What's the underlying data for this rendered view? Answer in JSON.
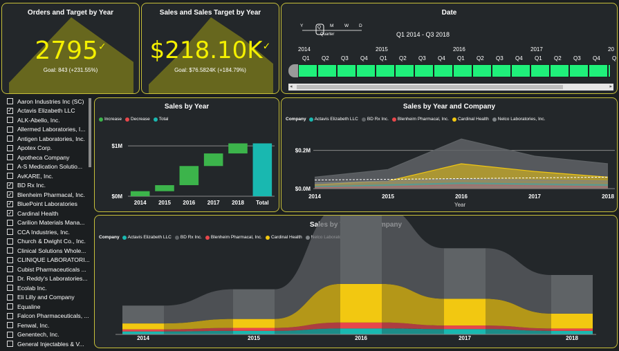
{
  "orders_card": {
    "title": "Orders and Target by Year",
    "value": "2795",
    "goal": "Goal: 843 (+231.55%)"
  },
  "sales_card": {
    "title": "Sales and Sales Target by Year",
    "value": "$218.10K",
    "goal": "Goal: $76.5824K (+184.79%)"
  },
  "date_slicer": {
    "title": "Date",
    "levels": [
      "Y",
      "Q",
      "M",
      "W",
      "D"
    ],
    "selected_level": "Quarter",
    "range": "Q1 2014 - Q3 2018",
    "years": [
      "2014",
      "2015",
      "2016",
      "2017",
      "20"
    ],
    "quarters": [
      "Q1",
      "Q2",
      "Q3",
      "Q4",
      "Q1",
      "Q2",
      "Q3",
      "Q4",
      "Q1",
      "Q2",
      "Q3",
      "Q4",
      "Q1",
      "Q2",
      "Q3",
      "Q4",
      "Q"
    ]
  },
  "company_slicer": {
    "items": [
      {
        "label": "Aaron Industries Inc (SC)",
        "checked": false
      },
      {
        "label": "Actavis Elizabeth LLC",
        "checked": true
      },
      {
        "label": "ALK-Abello, Inc.",
        "checked": false
      },
      {
        "label": "Allermed Laboratories, I...",
        "checked": false
      },
      {
        "label": "Antigen Laboratories, Inc.",
        "checked": false
      },
      {
        "label": "Apotex Corp.",
        "checked": false
      },
      {
        "label": "Apotheca Company",
        "checked": false
      },
      {
        "label": "A-S Medication Solutio...",
        "checked": false
      },
      {
        "label": "AvKARE, Inc.",
        "checked": false
      },
      {
        "label": "BD Rx Inc.",
        "checked": true
      },
      {
        "label": "Blenheim Pharmacal, Inc.",
        "checked": true
      },
      {
        "label": "BluePoint Laboratories",
        "checked": true
      },
      {
        "label": "Cardinal Health",
        "checked": true
      },
      {
        "label": "Carilion Materials Mana...",
        "checked": false
      },
      {
        "label": "CCA Industries, Inc.",
        "checked": false
      },
      {
        "label": "Church & Dwight Co., Inc.",
        "checked": false
      },
      {
        "label": "Clinical Solutions Whole...",
        "checked": false
      },
      {
        "label": "CLINIQUE LABORATORI...",
        "checked": false
      },
      {
        "label": "Cubist Pharmaceuticals ...",
        "checked": false
      },
      {
        "label": "Dr. Reddy's Laboratories...",
        "checked": false
      },
      {
        "label": "Ecolab Inc.",
        "checked": false
      },
      {
        "label": "Eli Lilly and Company",
        "checked": false
      },
      {
        "label": "Equaline",
        "checked": false
      },
      {
        "label": "Falcon Pharmaceuticals, ...",
        "checked": false
      },
      {
        "label": "Fenwal, Inc.",
        "checked": false
      },
      {
        "label": "Genentech, Inc.",
        "checked": false
      },
      {
        "label": "General Injectables & V...",
        "checked": false
      }
    ]
  },
  "waterfall": {
    "title": "Sales by Year",
    "legend": [
      {
        "label": "Increase",
        "color": "#3cb44b"
      },
      {
        "label": "Decrease",
        "color": "#e8474b"
      },
      {
        "label": "Total",
        "color": "#19b8b0"
      }
    ]
  },
  "line_chart": {
    "title": "Sales by Year and Company",
    "legend_label": "Company",
    "xlabel": "Year"
  },
  "ribbon_chart": {
    "title": "Sales by Year and Company",
    "legend_label": "Company"
  },
  "companies": [
    {
      "name": "Actavis Elizabeth LLC",
      "color": "#19b8b0"
    },
    {
      "name": "BD Rx Inc.",
      "color": "#5f6366"
    },
    {
      "name": "Blenheim Pharmacal, Inc.",
      "color": "#e8474b"
    },
    {
      "name": "Cardinal Health",
      "color": "#f2c811"
    },
    {
      "name": "Nelco Laboratories, Inc.",
      "color": "#7f8487"
    }
  ],
  "chart_data": [
    {
      "type": "area",
      "title": "Orders and Target by Year",
      "x": [
        "2014",
        "2015",
        "2016",
        "2017",
        "2018"
      ],
      "values": [
        140,
        520,
        900,
        640,
        380
      ]
    },
    {
      "type": "area",
      "title": "Sales and Sales Target by Year",
      "x": [
        "2014",
        "2015",
        "2016",
        "2017",
        "2018"
      ],
      "values": [
        10,
        40,
        75,
        55,
        30
      ]
    },
    {
      "type": "bar",
      "title": "Sales by Year",
      "categories": [
        "2014",
        "2015",
        "2016",
        "2017",
        "2018",
        "Total"
      ],
      "ylabel_ticks": [
        "$0M",
        "$1M"
      ],
      "ylim": [
        0,
        1.4
      ],
      "bars": [
        {
          "base": 0,
          "value": 0.1,
          "kind": "Increase"
        },
        {
          "base": 0.1,
          "value": 0.12,
          "kind": "Increase"
        },
        {
          "base": 0.22,
          "value": 0.38,
          "kind": "Increase"
        },
        {
          "base": 0.6,
          "value": 0.25,
          "kind": "Increase"
        },
        {
          "base": 0.85,
          "value": 0.2,
          "kind": "Increase"
        },
        {
          "base": 0,
          "value": 1.05,
          "kind": "Total"
        }
      ]
    },
    {
      "type": "area",
      "title": "Sales by Year and Company",
      "x": [
        "2014",
        "2015",
        "2016",
        "2017",
        "2018"
      ],
      "y_ticks": [
        "$0.0M",
        "$0.2M"
      ],
      "ylim": [
        0,
        0.3
      ],
      "series": [
        {
          "name": "BD Rx Inc.",
          "values": [
            0.06,
            0.1,
            0.26,
            0.17,
            0.13
          ]
        },
        {
          "name": "Cardinal Health",
          "values": [
            0.02,
            0.04,
            0.13,
            0.09,
            0.06
          ]
        },
        {
          "name": "Actavis Elizabeth LLC",
          "values": [
            0.01,
            0.02,
            0.03,
            0.025,
            0.02
          ]
        },
        {
          "name": "Blenheim Pharmacal, Inc.",
          "values": [
            0.005,
            0.01,
            0.02,
            0.015,
            0.01
          ]
        },
        {
          "name": "Nelco Laboratories, Inc.",
          "values": [
            0.03,
            0.04,
            0.05,
            0.045,
            0.04
          ]
        }
      ]
    },
    {
      "type": "area",
      "title": "Sales by Year and Company",
      "x": [
        "2014",
        "2015",
        "2016",
        "2017",
        "2018"
      ],
      "series": [
        {
          "name": "Actavis Elizabeth LLC",
          "values": [
            0.01,
            0.012,
            0.02,
            0.018,
            0.012
          ]
        },
        {
          "name": "Blenheim Pharmacal, Inc.",
          "values": [
            0.005,
            0.01,
            0.02,
            0.012,
            0.008
          ]
        },
        {
          "name": "Cardinal Health",
          "values": [
            0.02,
            0.03,
            0.13,
            0.09,
            0.05
          ]
        },
        {
          "name": "BD Rx Inc.",
          "values": [
            0.06,
            0.1,
            0.26,
            0.17,
            0.13
          ]
        }
      ]
    }
  ]
}
